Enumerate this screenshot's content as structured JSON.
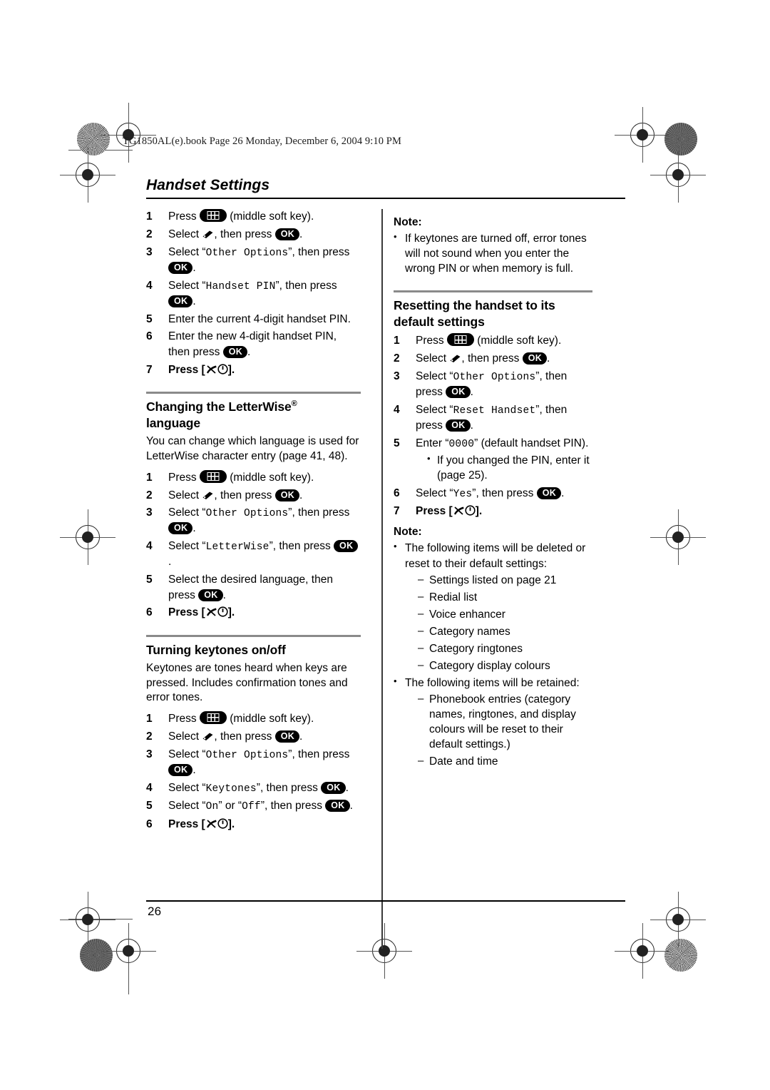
{
  "file_header": "TG1850AL(e).book  Page 26  Monday, December 6, 2004  9:10 PM",
  "running_head": "Handset Settings",
  "page_number": "26",
  "icons": {
    "soft_key": "soft-key-icon",
    "settings": "handset-settings-icon",
    "ok": "OK",
    "off_hook": "off-hook-key-icon"
  },
  "left_column": {
    "pin_steps": [
      {
        "num": "1",
        "pre": "Press ",
        "icon": "soft-key",
        "post": " (middle soft key)."
      },
      {
        "num": "2",
        "pre": "Select ",
        "icon": "settings",
        "mid": ", then press ",
        "icon2": "ok",
        "post": "."
      },
      {
        "num": "3",
        "pre": "Select “",
        "mono": "Other Options",
        "mid": "”, then press ",
        "icon2": "ok",
        "post": "."
      },
      {
        "num": "4",
        "pre": "Select “",
        "mono": "Handset PIN",
        "mid": "”, then press ",
        "icon2": "ok",
        "post": "."
      },
      {
        "num": "5",
        "pre": "Enter the current 4-digit handset PIN."
      },
      {
        "num": "6",
        "pre": "Enter the new 4-digit handset PIN, then press ",
        "icon2": "ok",
        "post": "."
      },
      {
        "num": "7",
        "pre": "Press [",
        "icon": "off-hook",
        "post": "]."
      }
    ],
    "letterwise": {
      "title_line1": "Changing the LetterWise",
      "title_sup": "®",
      "title_line2": "language",
      "intro": "You can change which language is used for LetterWise character entry (page 41, 48).",
      "steps": [
        {
          "num": "1",
          "pre": "Press ",
          "icon": "soft-key",
          "post": " (middle soft key)."
        },
        {
          "num": "2",
          "pre": "Select ",
          "icon": "settings",
          "mid": ", then press ",
          "icon2": "ok",
          "post": "."
        },
        {
          "num": "3",
          "pre": "Select “",
          "mono": "Other Options",
          "mid": "”, then press ",
          "icon2": "ok",
          "post": "."
        },
        {
          "num": "4",
          "pre": "Select “",
          "mono": "LetterWise",
          "mid": "”, then press ",
          "icon2": "ok",
          "post": "."
        },
        {
          "num": "5",
          "pre": "Select the desired language, then press ",
          "icon2": "ok",
          "post": "."
        },
        {
          "num": "6",
          "pre": "Press [",
          "icon": "off-hook",
          "post": "]."
        }
      ]
    },
    "keytones": {
      "title": "Turning keytones on/off",
      "intro": "Keytones are tones heard when keys are pressed. Includes confirmation tones and error tones.",
      "steps": [
        {
          "num": "1",
          "pre": "Press ",
          "icon": "soft-key",
          "post": " (middle soft key)."
        },
        {
          "num": "2",
          "pre": "Select ",
          "icon": "settings",
          "mid": ", then press ",
          "icon2": "ok",
          "post": "."
        },
        {
          "num": "3",
          "pre": "Select “",
          "mono": "Other Options",
          "mid": "”, then press ",
          "icon2": "ok",
          "post": "."
        },
        {
          "num": "4",
          "pre": "Select “",
          "mono": "Keytones",
          "mid": "”, then press ",
          "icon2": "ok",
          "post": "."
        },
        {
          "num": "5",
          "pre": "Select “",
          "mono": "On",
          "mid": "” or “",
          "mono2": "Off",
          "mid2": "”, then press ",
          "icon2": "ok",
          "post": "."
        },
        {
          "num": "6",
          "pre": "Press [",
          "icon": "off-hook",
          "post": "]."
        }
      ]
    }
  },
  "right_column": {
    "note1_label": "Note:",
    "note1_items": [
      "If keytones are turned off, error tones will not sound when you enter the wrong PIN or when memory is full."
    ],
    "reset": {
      "title_line1": "Resetting the handset to its",
      "title_line2": "default settings",
      "steps": [
        {
          "num": "1",
          "pre": "Press ",
          "icon": "soft-key",
          "post": " (middle soft key)."
        },
        {
          "num": "2",
          "pre": "Select ",
          "icon": "settings",
          "mid": ", then press ",
          "icon2": "ok",
          "post": "."
        },
        {
          "num": "3",
          "pre": "Select “",
          "mono": "Other Options",
          "mid": "”, then press ",
          "icon2": "ok",
          "post": "."
        },
        {
          "num": "4",
          "pre": "Select “",
          "mono": "Reset Handset",
          "mid": "”, then press ",
          "icon2": "ok",
          "post": "."
        },
        {
          "num": "5",
          "pre": "Enter “",
          "mono": "0000",
          "mid": "” (default handset PIN).",
          "sub": "If you changed the PIN, enter it (page 25)."
        },
        {
          "num": "6",
          "pre": "Select “",
          "mono": "Yes",
          "mid": "”, then press ",
          "icon2": "ok",
          "post": "."
        },
        {
          "num": "7",
          "pre": "Press [",
          "icon": "off-hook",
          "post": "]."
        }
      ]
    },
    "note2_label": "Note:",
    "note2": {
      "deleted_intro": "The following items will be deleted or reset to their default settings:",
      "deleted_items": [
        "Settings listed on page 21",
        "Redial list",
        "Voice enhancer",
        "Category names",
        "Category ringtones",
        "Category display colours"
      ],
      "retained_intro": "The following items will be retained:",
      "retained_items": [
        "Phonebook entries (category names, ringtones, and display colours will be reset to their default settings.)",
        "Date and time"
      ]
    }
  }
}
